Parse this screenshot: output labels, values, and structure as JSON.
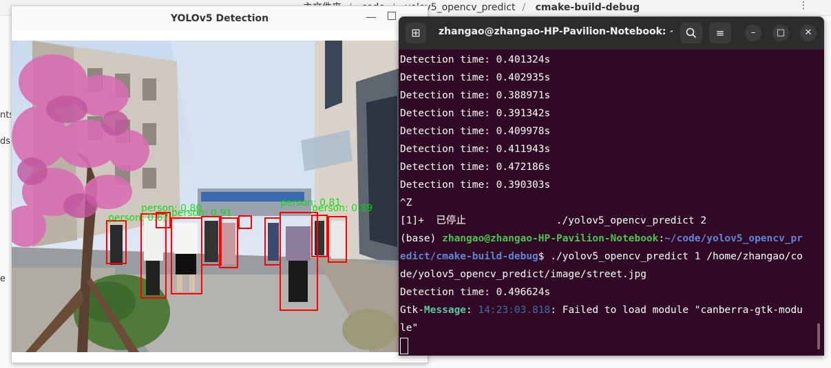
{
  "file_manager": {
    "breadcrumb": [
      "主文件夹",
      "code",
      "yolov5_opencv_predict",
      "cmake-build-debug"
    ],
    "menu_icon": "kebab-icon",
    "side_texts": [
      "nts",
      "ds",
      "e"
    ]
  },
  "yolo_window": {
    "title": "YOLOv5 Detection",
    "detections": [
      {
        "label": "person"
      },
      {
        "label": "person"
      },
      {
        "label": "person"
      },
      {
        "label": "person"
      },
      {
        "label": "person"
      },
      {
        "label": "person"
      },
      {
        "label": "person"
      },
      {
        "label": "person"
      },
      {
        "label": "person"
      },
      {
        "label": "person"
      },
      {
        "label": "person"
      }
    ],
    "label_texts": [
      "person: 0.67",
      "person: 0.80",
      "person: 0.91",
      "person: 0.81",
      "person: 0.89"
    ]
  },
  "terminal": {
    "title": "zhangao@zhangao-HP-Pavilion-Notebook: ~...",
    "lines": {
      "l1": "Detection time: 0.401324s",
      "l2": "Detection time: 0.402935s",
      "l3": "Detection time: 0.388971s",
      "l4": "Detection time: 0.391342s",
      "l5": "Detection time: 0.409978s",
      "l6": "Detection time: 0.411943s",
      "l7": "Detection time: 0.472186s",
      "l8": "Detection time: 0.390303s",
      "l9": "^Z",
      "l10": "[1]+  已停止               ./yolov5_opencv_predict 2",
      "prompt_base": "(base) ",
      "prompt_user": "zhangao@zhangao-HP-Pavilion-Notebook",
      "prompt_colon": ":",
      "prompt_path_a": "~/code/yolov5_opencv_pr",
      "prompt_path_b": "edict/cmake-build-debug",
      "cmd_a": "$ ./yolov5_opencv_predict 1 /home/zhangao/co",
      "cmd_b": "de/yolov5_opencv_predict/image/street.jpg",
      "l14": "Detection time: 0.496624s",
      "gtk_a": "Gtk-",
      "gtk_b": "Message",
      "gtk_c": ": ",
      "gtk_time": "14:23:03.818",
      "gtk_d": ": Failed to load module \"canberra-gtk-modu",
      "l16": "le\""
    }
  }
}
